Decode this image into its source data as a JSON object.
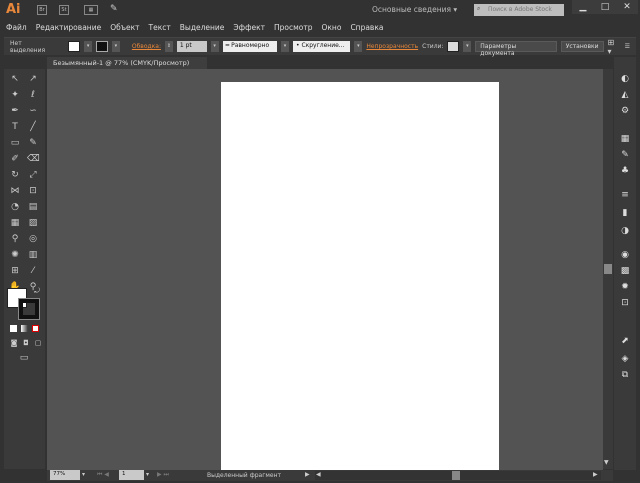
{
  "app": {
    "logo": "Ai",
    "workspace": "Основные сведения",
    "search_placeholder": "Поиск в Adobe Stock",
    "icons": [
      "bridge-icon",
      "stock-icon",
      "arrange-icon",
      "gpu-icon"
    ]
  },
  "window": {
    "minimize": "▁",
    "maximize": "□",
    "close": "✕"
  },
  "menu": [
    "Файл",
    "Редактирование",
    "Объект",
    "Текст",
    "Выделение",
    "Эффект",
    "Просмотр",
    "Окно",
    "Справка"
  ],
  "control": {
    "selection": "Нет выделения",
    "stroke_label": "Обводка:",
    "stroke_value": "1 pt",
    "profile": "Равномерно",
    "brush": "Скругление...",
    "opacity_label": "Непрозрачность",
    "styles_label": "Стили:",
    "doc_settings": "Параметры документа",
    "preferences": "Установки"
  },
  "tab": {
    "title": "Безымянный-1 @ 77% (CMYK/Просмотр)",
    "close": "×"
  },
  "status": {
    "zoom": "77%",
    "page": "1",
    "info": "Выделенный фрагмент"
  },
  "colors": {
    "accent": "#e9883a",
    "canvas": "#535353",
    "panel": "#3a3a3a"
  }
}
